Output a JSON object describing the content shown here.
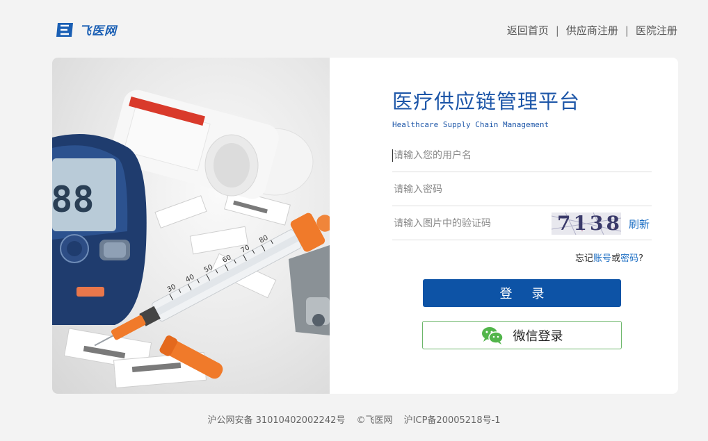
{
  "header": {
    "logo_text": "飞医网",
    "nav": [
      "返回首页",
      "供应商注册",
      "医院注册"
    ],
    "separator": "|"
  },
  "hero": {
    "syringe_marks": [
      "30",
      "40",
      "50",
      "60",
      "70",
      "80"
    ],
    "meter_digits": "88"
  },
  "login": {
    "title": "医疗供应链管理平台",
    "subtitle": "Healthcare Supply Chain Management",
    "username_placeholder": "请输入您的用户名",
    "password_placeholder": "请输入密码",
    "captcha_placeholder": "请输入图片中的验证码",
    "captcha_value": "7138",
    "refresh_label": "刷新",
    "forgot_prefix": "忘记",
    "forgot_account": "账号",
    "forgot_or": "或",
    "forgot_password": "密码",
    "forgot_suffix": "?",
    "login_label": "登录",
    "wechat_label": "微信登录"
  },
  "footer": {
    "beian": "沪公网安备 31010402002242号",
    "copyright": "©飞医网",
    "icp": "沪ICP备20005218号-1"
  },
  "colors": {
    "brand_blue": "#0d53a6",
    "title_blue": "#1d56a8",
    "link_blue": "#1d6fc4",
    "wechat_green": "#52b54b",
    "syringe_orange": "#f07a2a"
  }
}
